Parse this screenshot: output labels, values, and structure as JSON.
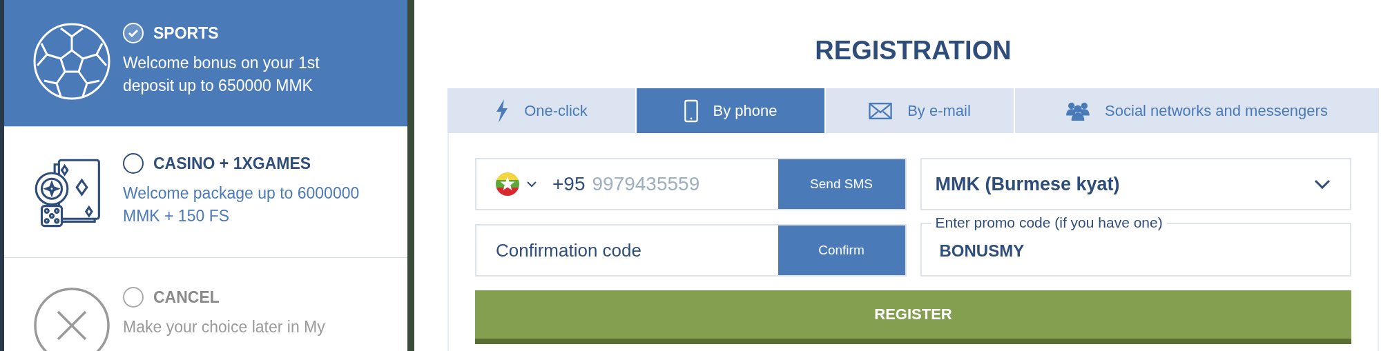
{
  "bonus_options": [
    {
      "kind": "sports",
      "title": "SPORTS",
      "description": "Welcome bonus on your 1st deposit up to 650000 MMK",
      "selected": true
    },
    {
      "kind": "casino",
      "title": "CASINO + 1XGAMES",
      "description": "Welcome package up to 6000000 MMK + 150 FS",
      "selected": false
    },
    {
      "kind": "cancel",
      "title": "CANCEL",
      "description": "Make your choice later in My",
      "selected": false
    }
  ],
  "registration": {
    "title": "REGISTRATION",
    "tabs": [
      {
        "kind": "one-click",
        "label": "One-click",
        "selected": false
      },
      {
        "kind": "phone",
        "label": "By phone",
        "selected": true
      },
      {
        "kind": "email",
        "label": "By e-mail",
        "selected": false
      },
      {
        "kind": "social",
        "label": "Social networks and messengers",
        "selected": false
      }
    ],
    "phone": {
      "country_code": "+95",
      "placeholder": "9979435559",
      "button": "Send SMS"
    },
    "currency": {
      "value": "MMK (Burmese kyat)"
    },
    "confirmation": {
      "placeholder": "Confirmation code",
      "button": "Confirm"
    },
    "promo": {
      "label": "Enter promo code (if you have one)",
      "value": "BONUSMY"
    },
    "register_button": "REGISTER"
  }
}
